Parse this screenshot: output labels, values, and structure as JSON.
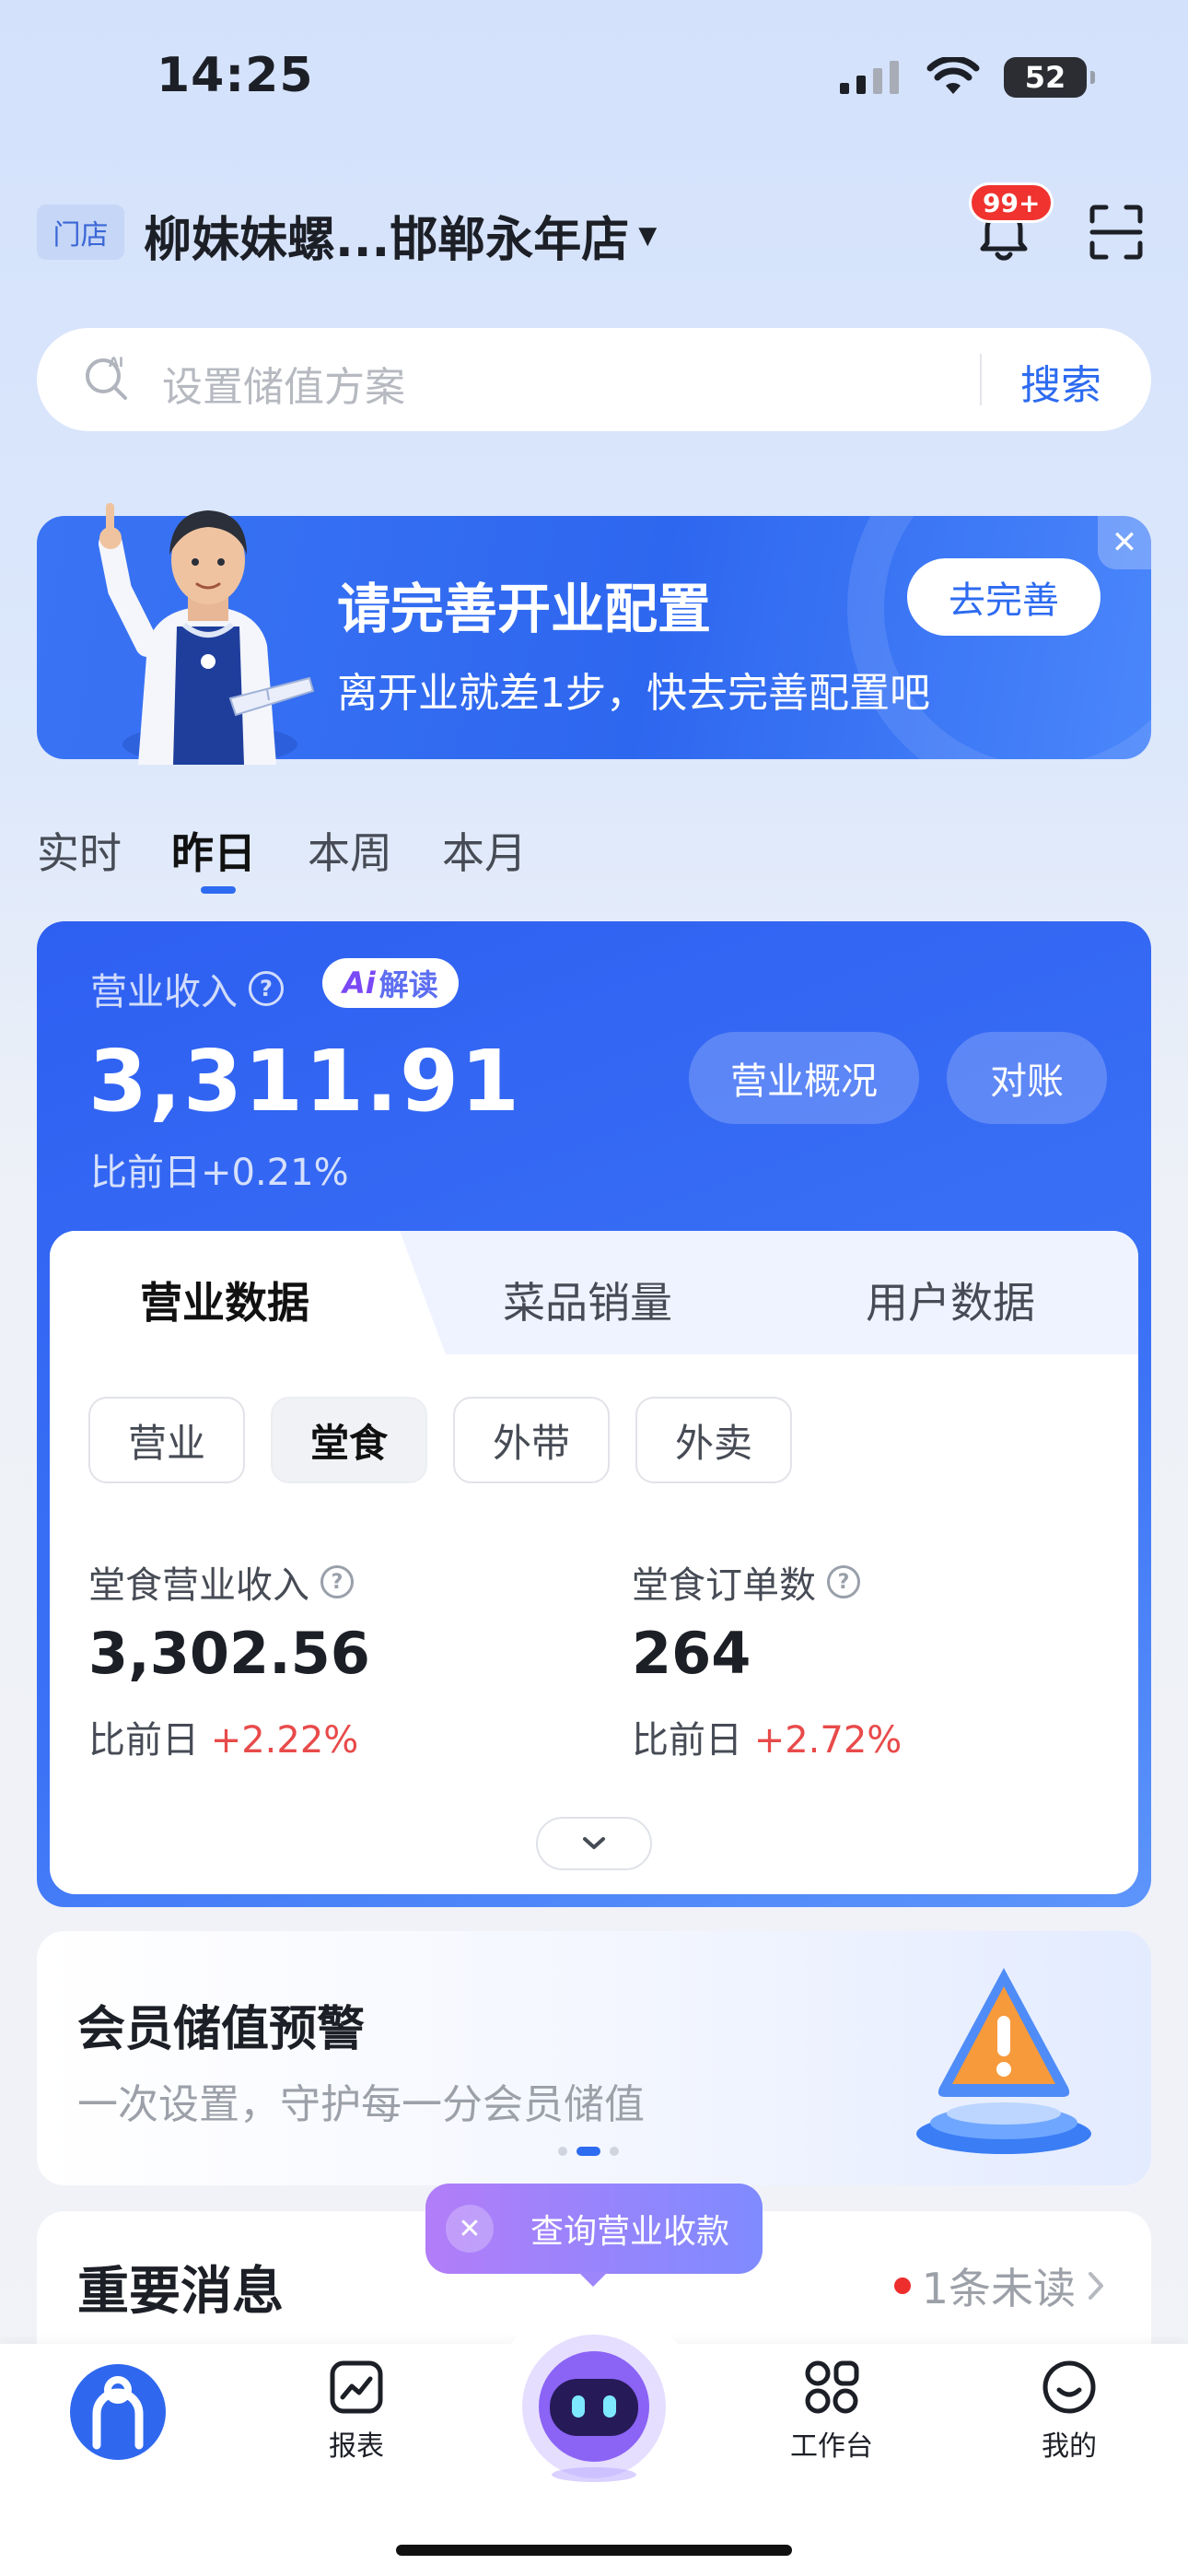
{
  "status": {
    "time": "14:25",
    "battery": "52"
  },
  "header": {
    "store_tag": "门店",
    "store_name": "柳妹妹螺...邯郸永年店",
    "notification_badge": "99+"
  },
  "search": {
    "placeholder": "设置储值方案",
    "button": "搜索"
  },
  "banner": {
    "title": "请完善开业配置",
    "subtitle": "离开业就差1步，快去完善配置吧",
    "button": "去完善",
    "close": "✕"
  },
  "period_tabs": [
    {
      "label": "实时",
      "active": false
    },
    {
      "label": "昨日",
      "active": true
    },
    {
      "label": "本周",
      "active": false
    },
    {
      "label": "本月",
      "active": false
    }
  ],
  "revenue": {
    "label": "营业收入",
    "ai_prefix": "Ai",
    "ai_suffix": "解读",
    "value": "3,311.91",
    "change": "比前日+0.21%",
    "overview_button": "营业概况",
    "reconcile_button": "对账"
  },
  "data_tabs": [
    "营业数据",
    "菜品销量",
    "用户数据"
  ],
  "chips": [
    {
      "label": "营业",
      "active": false
    },
    {
      "label": "堂食",
      "active": true
    },
    {
      "label": "外带",
      "active": false
    },
    {
      "label": "外卖",
      "active": false
    }
  ],
  "metrics": [
    {
      "label": "堂食营业收入",
      "value": "3,302.56",
      "change_prefix": "比前日",
      "change": "+2.22%"
    },
    {
      "label": "堂食订单数",
      "value": "264",
      "change_prefix": "比前日",
      "change": "+2.72%"
    }
  ],
  "member": {
    "title": "会员储值预警",
    "subtitle": "一次设置，守护每一分会员储值"
  },
  "messages": {
    "title": "重要消息",
    "unread": "1条未读"
  },
  "tooltip": {
    "text": "查询营业收款"
  },
  "nav": {
    "reports": "报表",
    "workbench": "工作台",
    "mine": "我的"
  },
  "colors": {
    "primary": "#2d6bf0",
    "increase": "#e84a4a",
    "badge": "#f0332f"
  }
}
